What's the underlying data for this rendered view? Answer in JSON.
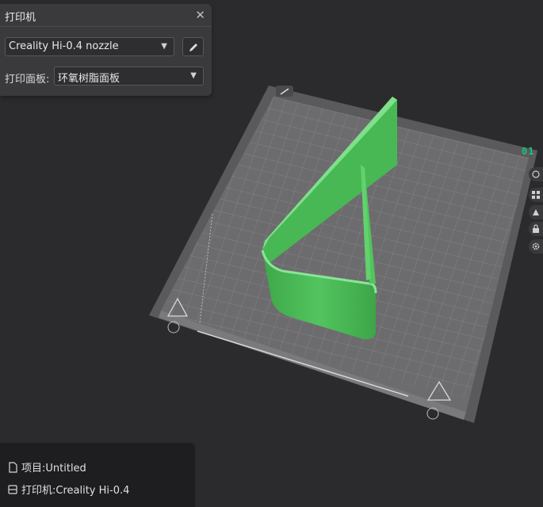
{
  "printer_panel": {
    "title": "打印机",
    "nozzle": "Creality Hi-0.4 nozzle",
    "plate_label": "打印面板:",
    "plate_value": "环氧树脂面板"
  },
  "viewport": {
    "plate_number": "01",
    "model_color": "#4cc25a",
    "plate_color": "#6e6e70"
  },
  "status": {
    "project": "项目:Untitled",
    "printer": "打印机:Creality Hi-0.4"
  },
  "icons": {
    "close": "close-icon",
    "caret": "chevron-down-icon",
    "edit": "pencil-icon"
  }
}
